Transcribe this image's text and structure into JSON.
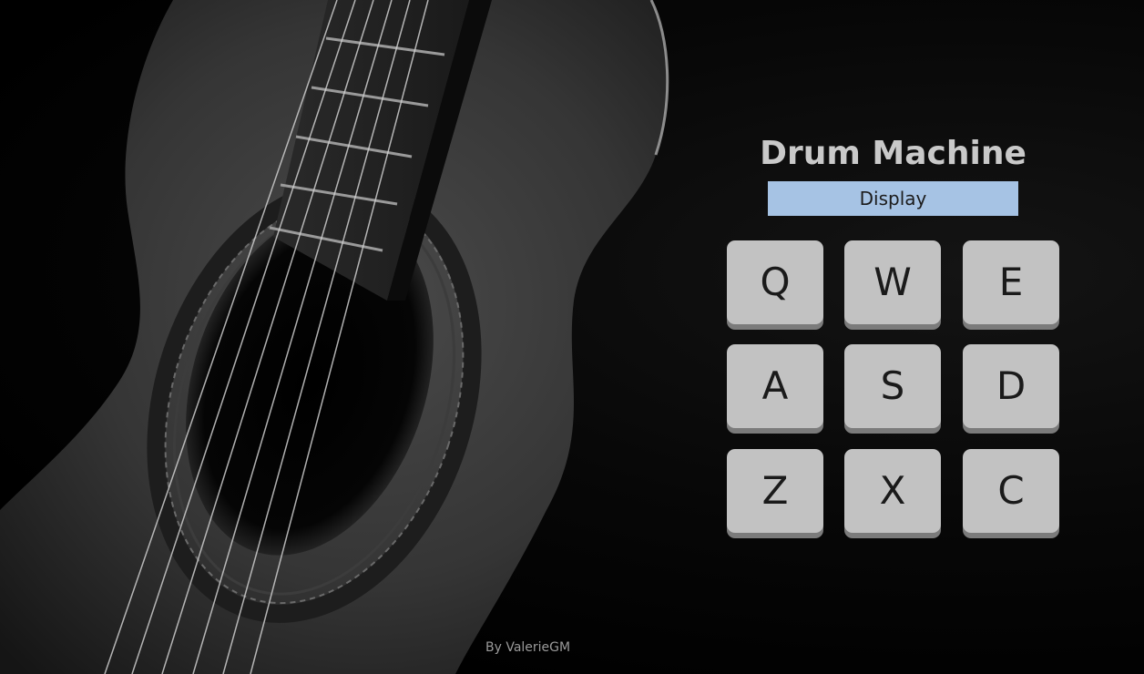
{
  "app": {
    "title": "Drum Machine",
    "display_text": "Display",
    "credit": "By ValerieGM"
  },
  "pads": [
    {
      "key": "Q"
    },
    {
      "key": "W"
    },
    {
      "key": "E"
    },
    {
      "key": "A"
    },
    {
      "key": "S"
    },
    {
      "key": "D"
    },
    {
      "key": "Z"
    },
    {
      "key": "X"
    },
    {
      "key": "C"
    }
  ],
  "colors": {
    "background": "#000000",
    "title": "#c9c9c9",
    "display_bg": "#a6c3e4",
    "pad_face": "#c2c2c2",
    "pad_shadow": "#7b7b7b",
    "credit": "#9a9a9a"
  },
  "background_image": "guitar-photo"
}
